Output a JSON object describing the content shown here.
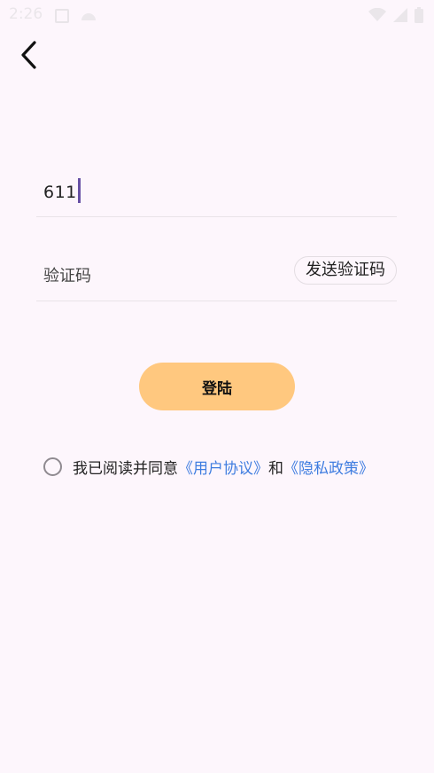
{
  "status_bar": {
    "time": "2:26",
    "icons": [
      "notification-icon",
      "android-icon",
      "wifi-icon",
      "signal-icon",
      "battery-icon"
    ]
  },
  "header": {
    "back_icon": "chevron-left-icon"
  },
  "phone_field": {
    "value": "611"
  },
  "code_field": {
    "placeholder": "验证码",
    "send_button_label": "发送验证码"
  },
  "login": {
    "button_label": "登陆"
  },
  "agreement": {
    "prefix": "我已阅读并同意",
    "user_agreement": "《用户协议》",
    "conjunction": "和",
    "privacy_policy": "《隐私政策》",
    "checked": false
  },
  "colors": {
    "background": "#fdf6fc",
    "accent_button": "#ffc87f",
    "link": "#3f7de0",
    "caret": "#6750a4"
  }
}
